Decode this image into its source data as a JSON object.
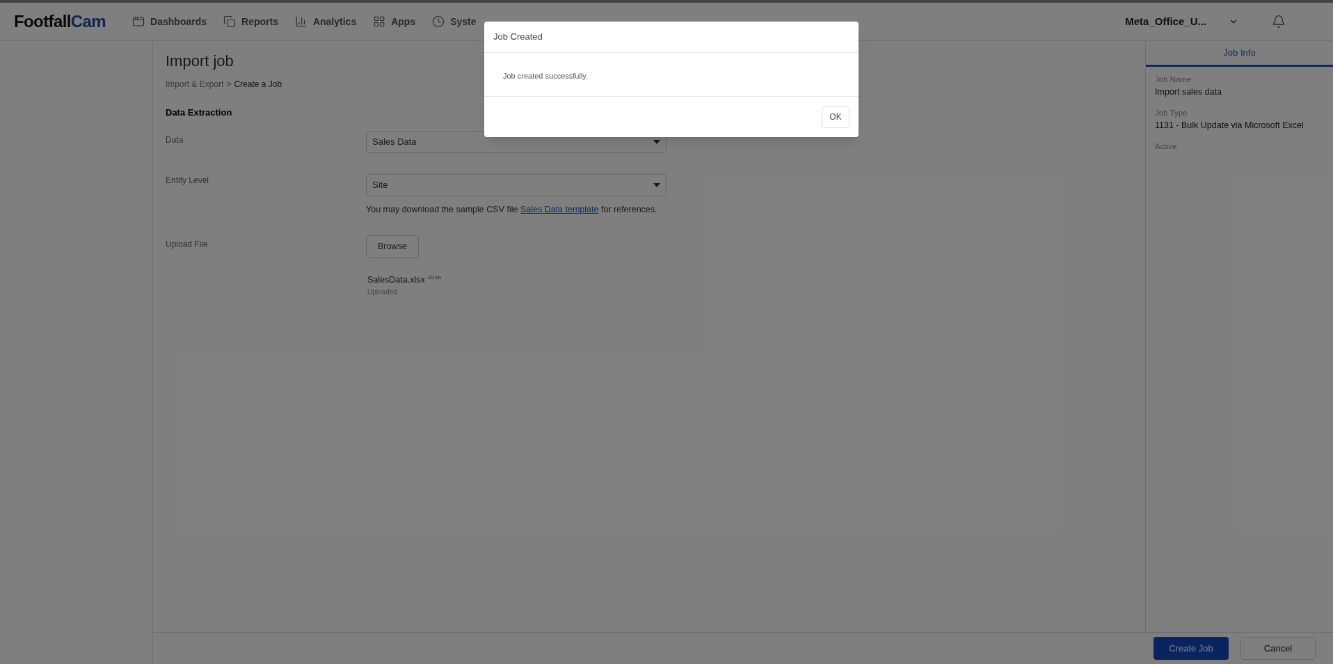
{
  "brand": {
    "part1": "Footfall",
    "part2": "Cam"
  },
  "nav": [
    {
      "label": "Dashboards"
    },
    {
      "label": "Reports"
    },
    {
      "label": "Analytics"
    },
    {
      "label": "Apps"
    },
    {
      "label": "Syste"
    }
  ],
  "account": "Meta_Office_U...",
  "page": {
    "title": "Import job",
    "breadcrumb": [
      "Import & Export",
      "Create a Job"
    ],
    "breadcrumb_separator": ">",
    "section": "Data Extraction"
  },
  "form": {
    "data": {
      "label": "Data",
      "value": "Sales Data"
    },
    "entity_level": {
      "label": "Entity Level",
      "value": "Site"
    },
    "help": {
      "before": "You may download the sample CSV file",
      "link": "Sales Data template",
      "after": "for references."
    },
    "upload": {
      "label": "Upload File",
      "button": "Browse",
      "file": {
        "name": "SalesData.xlsx",
        "size": "20 kb",
        "status": "Uploaded"
      }
    }
  },
  "job_info": {
    "tab": "Job Info",
    "fields": [
      {
        "label": "Job Name",
        "value": "Import sales data"
      },
      {
        "label": "Job Type",
        "value": "1131 - Bulk Update via Microsoft Excel"
      },
      {
        "label": "Active"
      }
    ]
  },
  "footer": {
    "buttons": [
      {
        "label": "Create Job",
        "kind": "primary"
      },
      {
        "label": "Cancel",
        "kind": "secondary"
      }
    ]
  },
  "dialog": {
    "title": "Job Created",
    "message": "Job created successfully.",
    "button": "OK"
  }
}
